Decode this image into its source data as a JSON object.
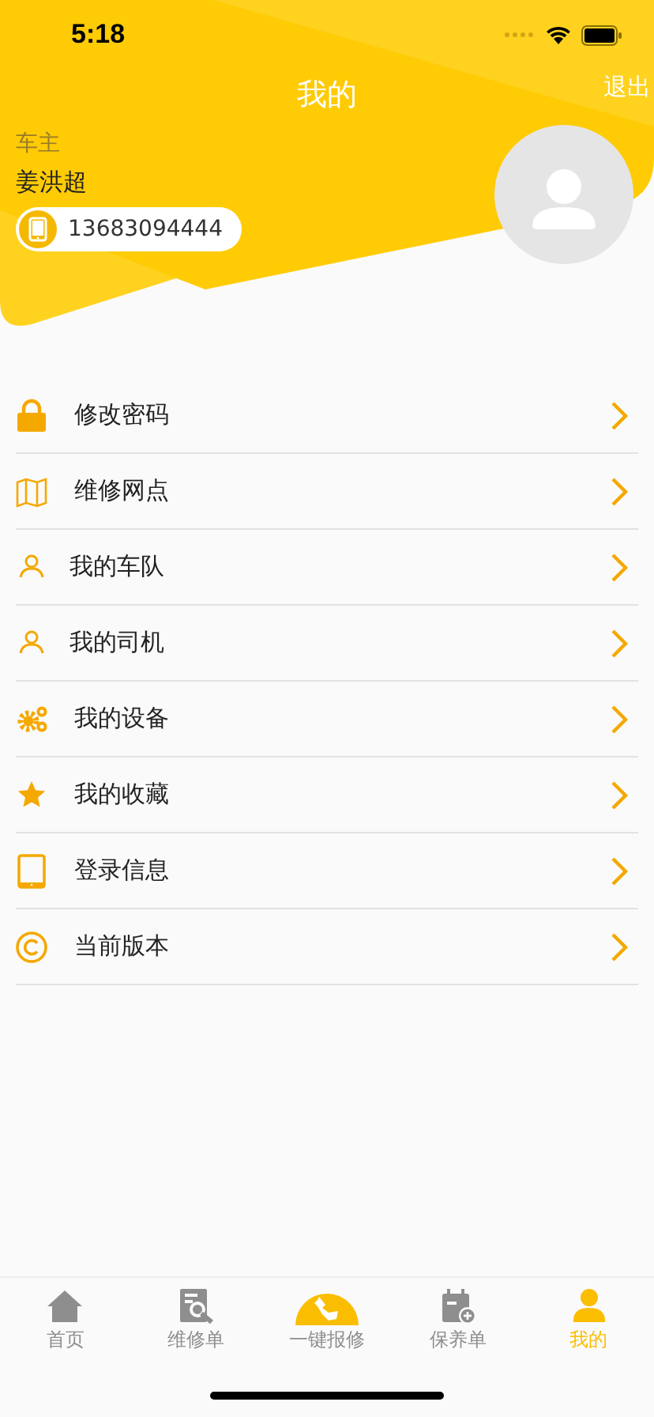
{
  "status_bar": {
    "time": "5:18"
  },
  "header": {
    "title": "我的",
    "logout": "退出"
  },
  "profile": {
    "role": "车主",
    "name": "姜洪超",
    "phone": "13683094444"
  },
  "menu": [
    {
      "kind": "lock",
      "label": "修改密码"
    },
    {
      "kind": "map",
      "label": "维修网点"
    },
    {
      "kind": "person",
      "label": "我的车队"
    },
    {
      "kind": "person",
      "label": "我的司机"
    },
    {
      "kind": "gears",
      "label": "我的设备"
    },
    {
      "kind": "star",
      "label": "我的收藏"
    },
    {
      "kind": "tablet",
      "label": "登录信息"
    },
    {
      "kind": "copyright",
      "label": "当前版本"
    }
  ],
  "tab_bar": [
    {
      "kind": "home",
      "label": "首页",
      "selected": false
    },
    {
      "kind": "repair",
      "label": "维修单",
      "selected": false
    },
    {
      "kind": "quick",
      "label": "一键报修",
      "selected": false
    },
    {
      "kind": "calendar",
      "label": "保养单",
      "selected": false
    },
    {
      "kind": "user",
      "label": "我的",
      "selected": true
    }
  ]
}
